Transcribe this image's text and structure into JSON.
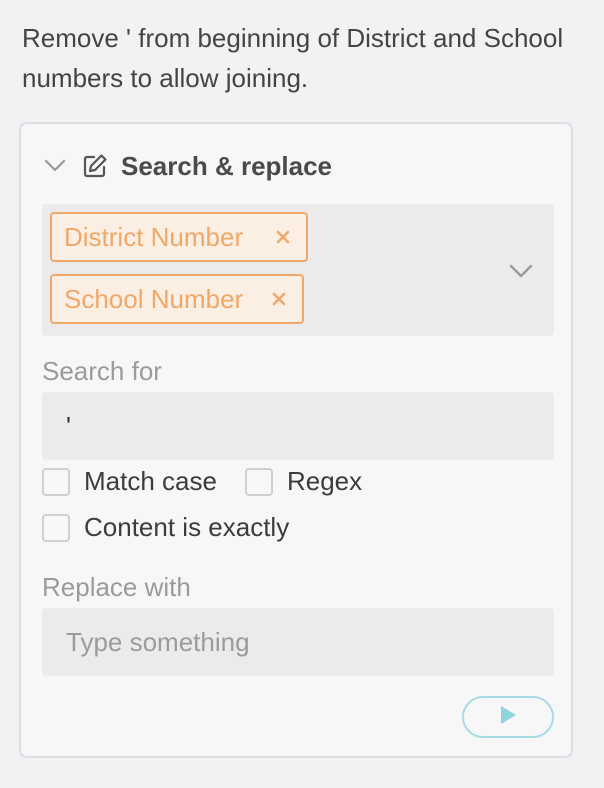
{
  "step": {
    "description": "Remove ' from beginning of District and School numbers to allow joining."
  },
  "panel": {
    "title": "Search & replace",
    "icons": {
      "collapse": "chevron-down-icon",
      "edit": "edit-icon",
      "dropdown": "chevron-down-icon",
      "remove_tag": "close-icon",
      "run": "play-icon"
    },
    "columns": [
      {
        "label": "District Number"
      },
      {
        "label": "School Number"
      }
    ],
    "search": {
      "label": "Search for",
      "value": "'"
    },
    "options": {
      "match_case": {
        "label": "Match case",
        "checked": false
      },
      "regex": {
        "label": "Regex",
        "checked": false
      },
      "exact": {
        "label": "Content is exactly",
        "checked": false
      }
    },
    "replace": {
      "label": "Replace with",
      "value": "",
      "placeholder": "Type something"
    }
  },
  "colors": {
    "background": "#f2f2f5",
    "panel": "#f7f7f7",
    "tag_accent": "#f0a86a",
    "run_accent": "#8fd3dc",
    "input_bg": "#ebebeb"
  }
}
